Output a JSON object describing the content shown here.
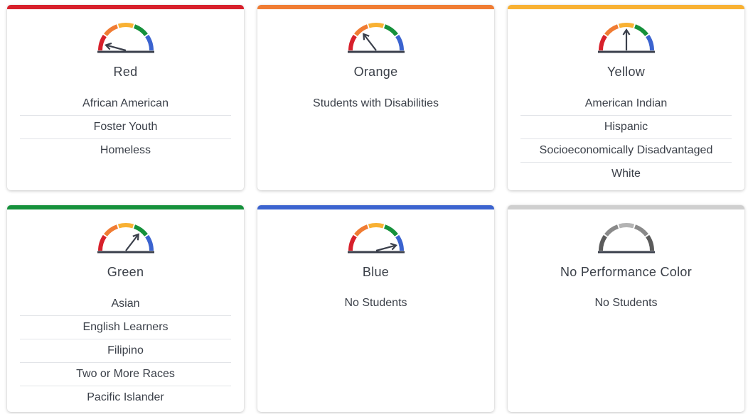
{
  "cards": [
    {
      "title": "Red",
      "bar_color": "#d7202b",
      "gauge": "colored",
      "needle_level": 0.0,
      "groups": [
        "African American",
        "Foster Youth",
        "Homeless"
      ]
    },
    {
      "title": "Orange",
      "bar_color": "#f07c33",
      "gauge": "colored",
      "needle_level": 0.25,
      "groups": [
        "Students with Disabilities"
      ]
    },
    {
      "title": "Yellow",
      "bar_color": "#f8b133",
      "gauge": "colored",
      "needle_level": 0.5,
      "groups": [
        "American Indian",
        "Hispanic",
        "Socioeconomically Disadvantaged",
        "White"
      ]
    },
    {
      "title": "Green",
      "bar_color": "#15913b",
      "gauge": "colored",
      "needle_level": 0.75,
      "groups": [
        "Asian",
        "English Learners",
        "Filipino",
        "Two or More Races",
        "Pacific Islander"
      ]
    },
    {
      "title": "Blue",
      "bar_color": "#3b63cf",
      "gauge": "colored",
      "needle_level": 1.0,
      "groups": [],
      "empty_text": "No Students"
    },
    {
      "title": "No Performance Color",
      "bar_color": "#cfcfcf",
      "gauge": "gray",
      "groups": [],
      "empty_text": "No Students"
    }
  ],
  "gauge_colors": {
    "colored": [
      "#d7202b",
      "#f07c33",
      "#f8b133",
      "#15913b",
      "#3b63cf"
    ],
    "gray": [
      "#5b5b5b",
      "#8a8a8a",
      "#b3b3b3",
      "#8a8a8a",
      "#5b5b5b"
    ],
    "needle": "#3a3f4b",
    "base": "#3a3f4b"
  }
}
